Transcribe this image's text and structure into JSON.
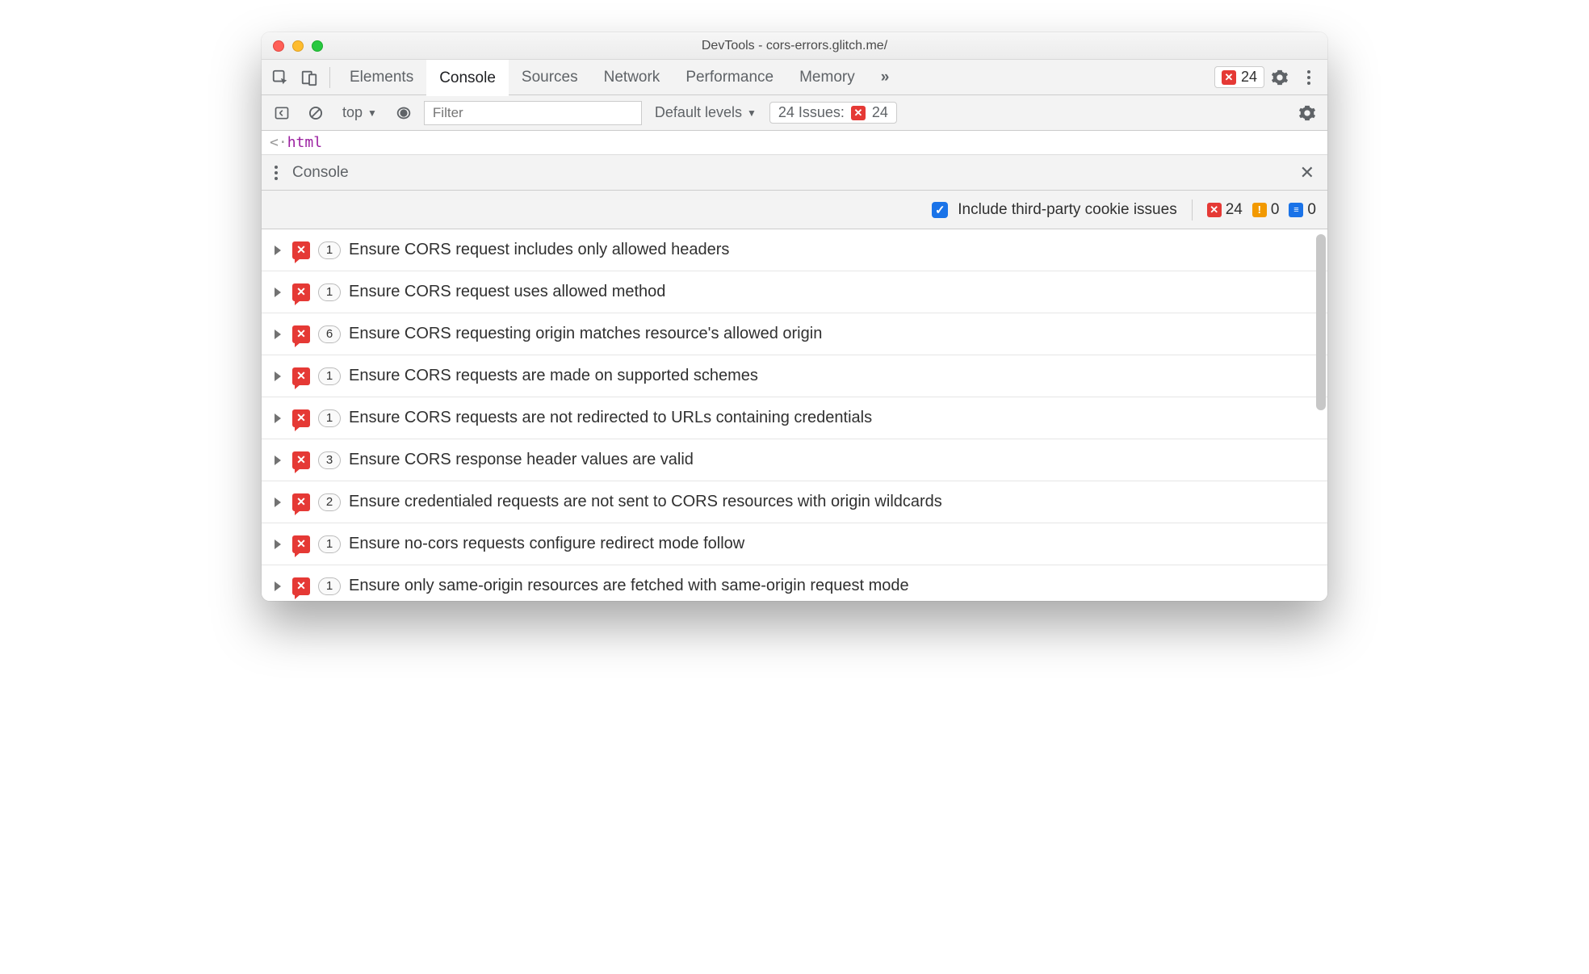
{
  "window": {
    "title": "DevTools - cors-errors.glitch.me/"
  },
  "tabs": {
    "items": [
      "Elements",
      "Console",
      "Sources",
      "Network",
      "Performance",
      "Memory"
    ],
    "active": "Console",
    "overflow_icon": "»",
    "error_count": "24"
  },
  "toolbar": {
    "context": "top",
    "filter_placeholder": "Filter",
    "levels": "Default levels",
    "issues_label": "24 Issues:",
    "issues_count": "24"
  },
  "source_hint": {
    "prefix": "<·",
    "tag": "html"
  },
  "drawer": {
    "title": "Console"
  },
  "issues_bar": {
    "checkbox_label": "Include third-party cookie issues",
    "checked": true,
    "errors": "24",
    "warnings": "0",
    "infos": "0"
  },
  "issues": [
    {
      "count": "1",
      "text": "Ensure CORS request includes only allowed headers"
    },
    {
      "count": "1",
      "text": "Ensure CORS request uses allowed method"
    },
    {
      "count": "6",
      "text": "Ensure CORS requesting origin matches resource's allowed origin"
    },
    {
      "count": "1",
      "text": "Ensure CORS requests are made on supported schemes"
    },
    {
      "count": "1",
      "text": "Ensure CORS requests are not redirected to URLs containing credentials"
    },
    {
      "count": "3",
      "text": "Ensure CORS response header values are valid"
    },
    {
      "count": "2",
      "text": "Ensure credentialed requests are not sent to CORS resources with origin wildcards"
    },
    {
      "count": "1",
      "text": "Ensure no-cors requests configure redirect mode follow"
    },
    {
      "count": "1",
      "text": "Ensure only same-origin resources are fetched with same-origin request mode"
    }
  ]
}
